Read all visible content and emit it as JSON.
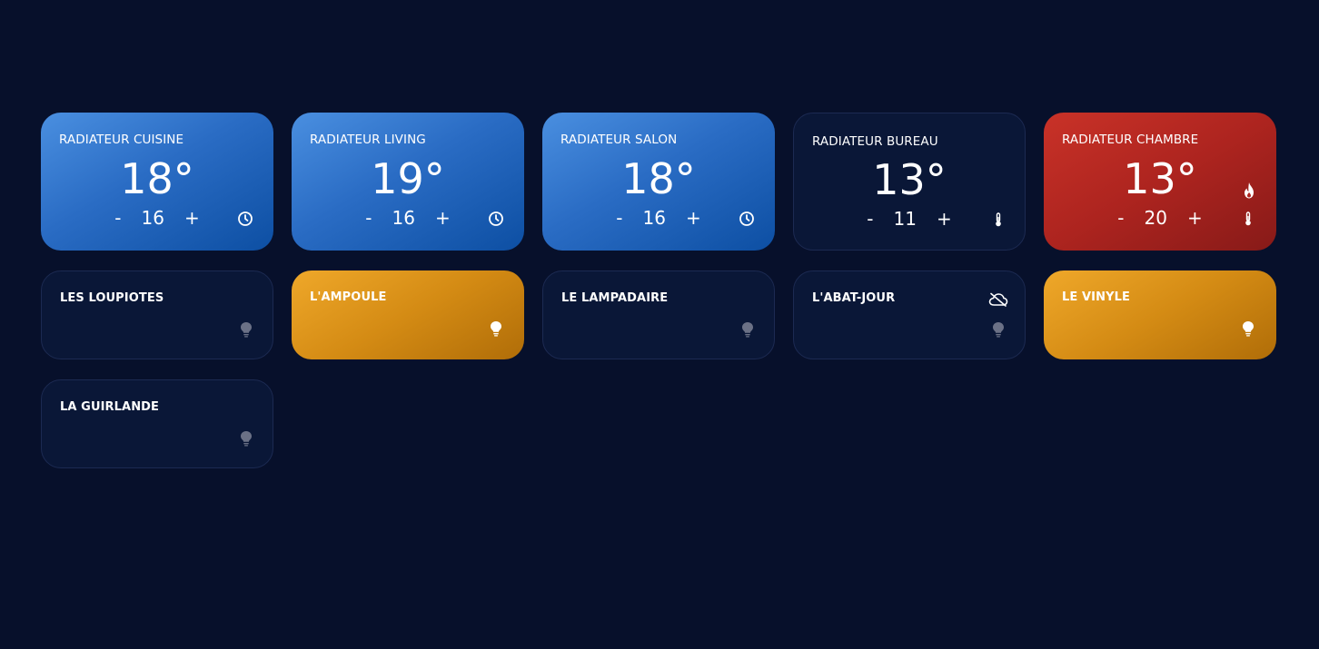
{
  "heaters": [
    {
      "name": "RADIATEUR CUISINE",
      "temperature": "18°",
      "setpoint": "16",
      "minus": "-",
      "plus": "+",
      "mode_icon": "clock-icon",
      "state": "schedule",
      "color": "#2a6cc4"
    },
    {
      "name": "RADIATEUR LIVING",
      "temperature": "19°",
      "setpoint": "16",
      "minus": "-",
      "plus": "+",
      "mode_icon": "clock-icon",
      "state": "schedule",
      "color": "#2a6cc4"
    },
    {
      "name": "RADIATEUR SALON",
      "temperature": "18°",
      "setpoint": "16",
      "minus": "-",
      "plus": "+",
      "mode_icon": "clock-icon",
      "state": "schedule",
      "color": "#2a6cc4"
    },
    {
      "name": "RADIATEUR BUREAU",
      "temperature": "13°",
      "setpoint": "11",
      "minus": "-",
      "plus": "+",
      "mode_icon": "thermometer-icon",
      "state": "idle",
      "color": "#0a1737"
    },
    {
      "name": "RADIATEUR CHAMBRE",
      "temperature": "13°",
      "setpoint": "20",
      "minus": "-",
      "plus": "+",
      "mode_icon": "thermometer-icon",
      "status_icon": "flame-icon",
      "state": "heating",
      "color": "#ad241f"
    }
  ],
  "lights": [
    {
      "name": "LES LOUPIOTES",
      "state": "off",
      "icon": "lightbulb-icon",
      "color": "#0a1737"
    },
    {
      "name": "L'AMPOULE",
      "state": "on",
      "icon": "lightbulb-icon",
      "color": "#d48b14"
    },
    {
      "name": "LE LAMPADAIRE",
      "state": "off",
      "icon": "lightbulb-icon",
      "color": "#0a1737"
    },
    {
      "name": "L'ABAT-JOUR",
      "state": "off",
      "icon": "lightbulb-icon",
      "status_icon": "cloud-off-icon",
      "color": "#0a1737"
    },
    {
      "name": "LE VINYLE",
      "state": "on",
      "icon": "lightbulb-icon",
      "color": "#d48b14"
    },
    {
      "name": "LA GUIRLANDE",
      "state": "off",
      "icon": "lightbulb-icon",
      "color": "#0a1737"
    }
  ],
  "colors": {
    "background": "#07102b",
    "blue": "#2a6cc4",
    "dark_card": "#0a1737",
    "red": "#ad241f",
    "amber": "#d48b14",
    "bulb_off": "#6b7186",
    "bulb_on": "#ffffff"
  }
}
